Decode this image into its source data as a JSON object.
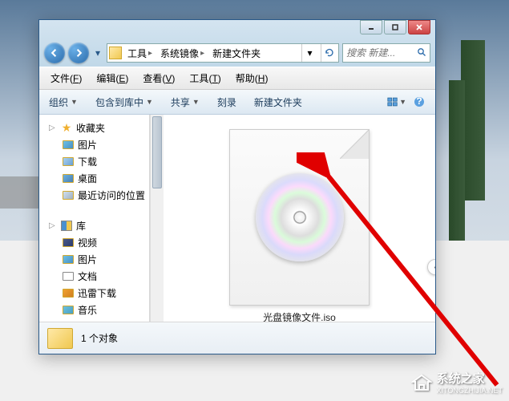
{
  "breadcrumb": {
    "items": [
      "工具",
      "系统镜像",
      "新建文件夹"
    ]
  },
  "search": {
    "placeholder": "搜索 新建..."
  },
  "menubar": [
    {
      "label": "文件",
      "accel": "F"
    },
    {
      "label": "编辑",
      "accel": "E"
    },
    {
      "label": "查看",
      "accel": "V"
    },
    {
      "label": "工具",
      "accel": "T"
    },
    {
      "label": "帮助",
      "accel": "H"
    }
  ],
  "toolbar": {
    "organize": "组织",
    "include": "包含到库中",
    "share": "共享",
    "burn": "刻录",
    "newfolder": "新建文件夹"
  },
  "sidebar": {
    "favorites": {
      "label": "收藏夹",
      "items": [
        "图片",
        "下载",
        "桌面",
        "最近访问的位置"
      ]
    },
    "libraries": {
      "label": "库",
      "items": [
        "视频",
        "图片",
        "文档",
        "迅雷下载",
        "音乐"
      ]
    }
  },
  "file": {
    "name": "光盘镜像文件.iso"
  },
  "status": {
    "count": "1 个对象"
  },
  "watermark": {
    "brand": "系统之家",
    "url": "XITONGZHIJIA.NET"
  }
}
